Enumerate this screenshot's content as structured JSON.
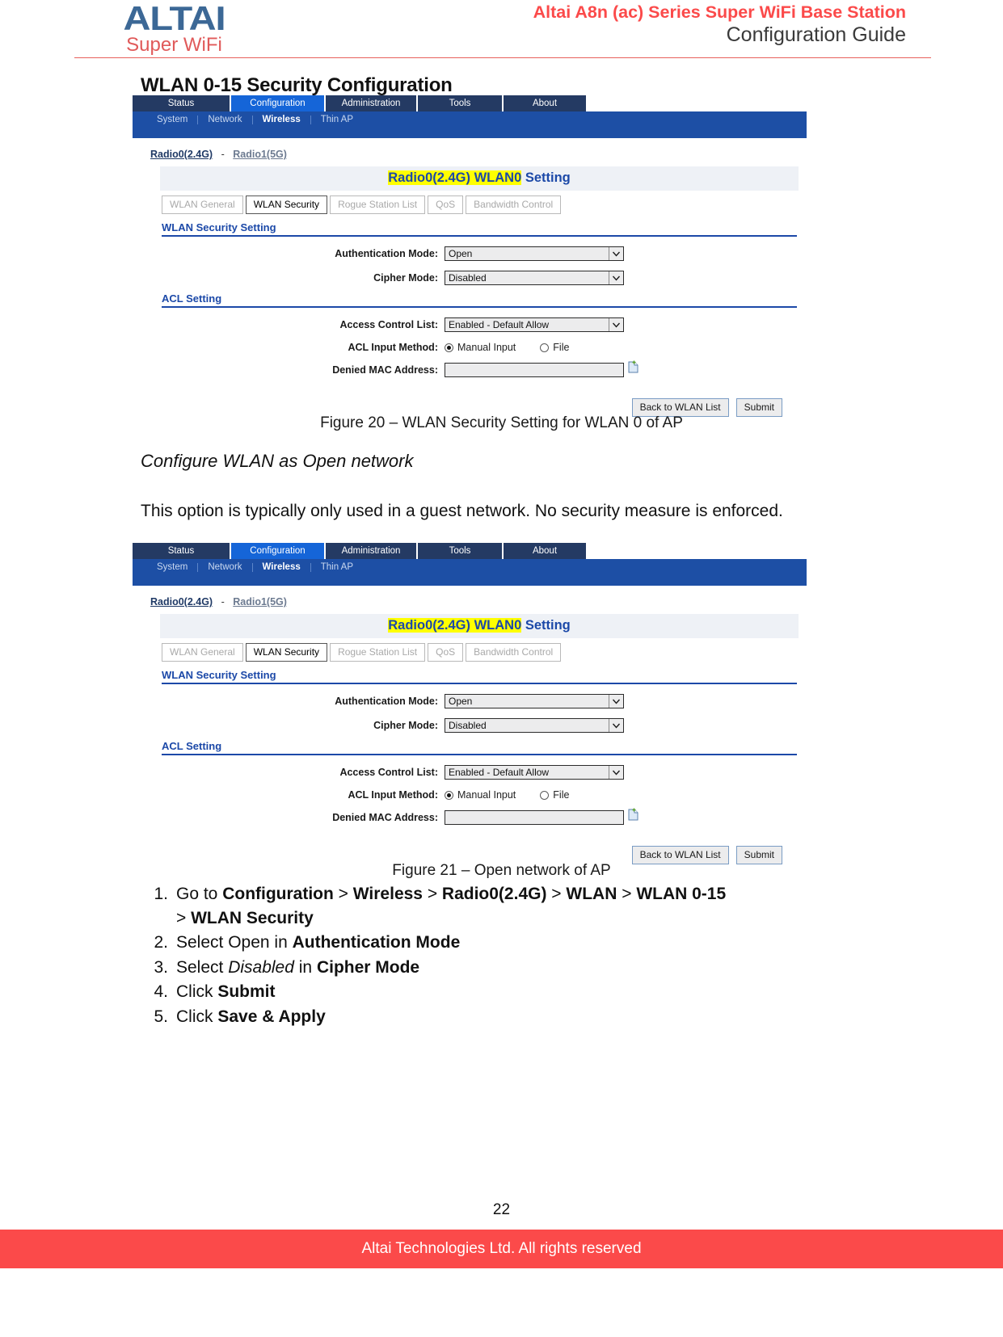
{
  "header": {
    "logo_primary": "ALTAI",
    "logo_secondary": "Super WiFi",
    "title": "Altai A8n (ac) Series Super WiFi Base Station",
    "subtitle": "Configuration Guide"
  },
  "section_heading": "WLAN 0-15 Security Configuration",
  "screenshots": [
    {
      "nav_tabs": [
        {
          "label": "Status",
          "active": false
        },
        {
          "label": "Configuration",
          "active": true
        },
        {
          "label": "Administration",
          "active": false
        },
        {
          "label": "Tools",
          "active": false
        },
        {
          "label": "About",
          "active": false
        }
      ],
      "subnav": [
        {
          "label": "System",
          "active": false
        },
        {
          "label": "Network",
          "active": false
        },
        {
          "label": "Wireless",
          "active": true
        },
        {
          "label": "Thin AP",
          "active": false
        }
      ],
      "radio_links": {
        "active": "Radio0(2.4G)",
        "separator": "-",
        "inactive": "Radio1(5G)"
      },
      "panel_title": {
        "highlight": "Radio0(2.4G) WLAN0",
        "suffix": " Setting"
      },
      "subtabs": [
        {
          "label": "WLAN General",
          "active": false
        },
        {
          "label": "WLAN Security",
          "active": true
        },
        {
          "label": "Rogue Station List",
          "active": false
        },
        {
          "label": "QoS",
          "active": false
        },
        {
          "label": "Bandwidth Control",
          "active": false
        }
      ],
      "security_group_label": "WLAN Security Setting",
      "fields": {
        "auth_mode_label": "Authentication Mode:",
        "auth_mode_value": "Open",
        "cipher_mode_label": "Cipher Mode:",
        "cipher_mode_value": "Disabled"
      },
      "acl_group_label": "ACL Setting",
      "acl": {
        "access_control_list_label": "Access Control List:",
        "access_control_list_value": "Enabled - Default Allow",
        "input_method_label": "ACL Input Method:",
        "input_method_options": [
          {
            "label": "Manual Input",
            "selected": true
          },
          {
            "label": "File",
            "selected": false
          }
        ],
        "denied_mac_label": "Denied MAC Address:",
        "denied_mac_value": ""
      },
      "buttons": {
        "back": "Back to WLAN List",
        "submit": "Submit"
      }
    },
    {
      "nav_tabs": [
        {
          "label": "Status",
          "active": false
        },
        {
          "label": "Configuration",
          "active": true
        },
        {
          "label": "Administration",
          "active": false
        },
        {
          "label": "Tools",
          "active": false
        },
        {
          "label": "About",
          "active": false
        }
      ],
      "subnav": [
        {
          "label": "System",
          "active": false
        },
        {
          "label": "Network",
          "active": false
        },
        {
          "label": "Wireless",
          "active": true
        },
        {
          "label": "Thin AP",
          "active": false
        }
      ],
      "radio_links": {
        "active": "Radio0(2.4G)",
        "separator": "-",
        "inactive": "Radio1(5G)"
      },
      "panel_title": {
        "highlight": "Radio0(2.4G) WLAN0",
        "suffix": " Setting"
      },
      "subtabs": [
        {
          "label": "WLAN General",
          "active": false
        },
        {
          "label": "WLAN Security",
          "active": true
        },
        {
          "label": "Rogue Station List",
          "active": false
        },
        {
          "label": "QoS",
          "active": false
        },
        {
          "label": "Bandwidth Control",
          "active": false
        }
      ],
      "security_group_label": "WLAN Security Setting",
      "fields": {
        "auth_mode_label": "Authentication Mode:",
        "auth_mode_value": "Open",
        "cipher_mode_label": "Cipher Mode:",
        "cipher_mode_value": "Disabled"
      },
      "acl_group_label": "ACL Setting",
      "acl": {
        "access_control_list_label": "Access Control List:",
        "access_control_list_value": "Enabled - Default Allow",
        "input_method_label": "ACL Input Method:",
        "input_method_options": [
          {
            "label": "Manual Input",
            "selected": true
          },
          {
            "label": "File",
            "selected": false
          }
        ],
        "denied_mac_label": "Denied MAC Address:",
        "denied_mac_value": ""
      },
      "buttons": {
        "back": "Back to WLAN List",
        "submit": "Submit"
      }
    }
  ],
  "figure_captions": {
    "figure20": "Figure 20 – WLAN Security Setting for WLAN 0 of AP",
    "figure21": "Figure 21 – Open network of AP"
  },
  "subheading_italic": "Configure WLAN as Open network",
  "body_paragraph": "This option is typically only used in a guest network. No security measure is enforced.",
  "steps": [
    {
      "num": "1.",
      "html": "Go to <b>Configuration</b> &gt; <b>Wireless</b> &gt; <b>Radio0(2.4G)</b> &gt; <b>WLAN</b> &gt; <b>WLAN 0-15</b><br>&gt; <b>WLAN Security</b>"
    },
    {
      "num": "2.",
      "html": "Select Open in <b>Authentication Mode</b>"
    },
    {
      "num": "3.",
      "html": "Select <i>Disabled</i> in <b>Cipher Mode</b>"
    },
    {
      "num": "4.",
      "html": "Click <b>Submit</b>"
    },
    {
      "num": "5.",
      "html": "Click <b>Save &amp; Apply</b>"
    }
  ],
  "page_number": "22",
  "footer": {
    "text": "Altai Technologies Ltd. All rights reserved"
  },
  "colors": {
    "brand_red": "#fb4a4a",
    "logo_blue": "#3c6896",
    "nav_dark": "#243a63",
    "nav_active": "#1565d8",
    "subnav_blue": "#1d4fa5",
    "heading_blue": "#1c49a8",
    "highlight_yellow": "#ffff00"
  }
}
